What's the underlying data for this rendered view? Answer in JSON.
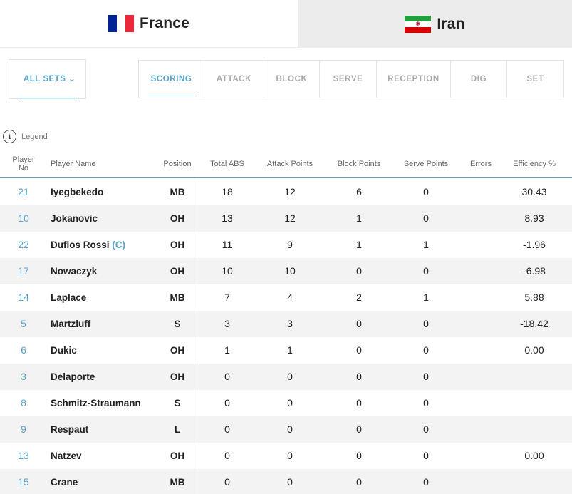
{
  "teams": [
    {
      "name": "France",
      "flag": "france-flag",
      "colors": [
        "#002395",
        "#ffffff",
        "#ed2939"
      ],
      "active": true
    },
    {
      "name": "Iran",
      "flag": "iran-flag",
      "colors": [
        "#239f40",
        "#ffffff",
        "#da0000"
      ],
      "active": false
    }
  ],
  "filters": {
    "sets_label": "ALL SETS ⌄"
  },
  "categories": [
    "SCORING",
    "ATTACK",
    "BLOCK",
    "SERVE",
    "RECEPTION",
    "DIG",
    "SET"
  ],
  "active_category": "SCORING",
  "legend": {
    "label": "Legend",
    "icon": "info-icon"
  },
  "table": {
    "headers": {
      "player_no_line1": "Player",
      "player_no_line2": "No",
      "player_name": "Player Name",
      "position": "Position",
      "total_abs": "Total ABS",
      "attack_points": "Attack Points",
      "block_points": "Block Points",
      "serve_points": "Serve Points",
      "errors": "Errors",
      "efficiency": "Efficiency %"
    },
    "rows": [
      {
        "no": "21",
        "name": "Iyegbekedo",
        "captain": "",
        "pos": "MB",
        "abs": "18",
        "att": "12",
        "blk": "6",
        "srv": "0",
        "err": "",
        "eff": "30.43"
      },
      {
        "no": "10",
        "name": "Jokanovic",
        "captain": "",
        "pos": "OH",
        "abs": "13",
        "att": "12",
        "blk": "1",
        "srv": "0",
        "err": "",
        "eff": "8.93"
      },
      {
        "no": "22",
        "name": "Duflos Rossi",
        "captain": "(C)",
        "pos": "OH",
        "abs": "11",
        "att": "9",
        "blk": "1",
        "srv": "1",
        "err": "",
        "eff": "-1.96"
      },
      {
        "no": "17",
        "name": "Nowaczyk",
        "captain": "",
        "pos": "OH",
        "abs": "10",
        "att": "10",
        "blk": "0",
        "srv": "0",
        "err": "",
        "eff": "-6.98"
      },
      {
        "no": "14",
        "name": "Laplace",
        "captain": "",
        "pos": "MB",
        "abs": "7",
        "att": "4",
        "blk": "2",
        "srv": "1",
        "err": "",
        "eff": "5.88"
      },
      {
        "no": "5",
        "name": "Martzluff",
        "captain": "",
        "pos": "S",
        "abs": "3",
        "att": "3",
        "blk": "0",
        "srv": "0",
        "err": "",
        "eff": "-18.42"
      },
      {
        "no": "6",
        "name": "Dukic",
        "captain": "",
        "pos": "OH",
        "abs": "1",
        "att": "1",
        "blk": "0",
        "srv": "0",
        "err": "",
        "eff": "0.00"
      },
      {
        "no": "3",
        "name": "Delaporte",
        "captain": "",
        "pos": "OH",
        "abs": "0",
        "att": "0",
        "blk": "0",
        "srv": "0",
        "err": "",
        "eff": ""
      },
      {
        "no": "8",
        "name": "Schmitz-Straumann",
        "captain": "",
        "pos": "S",
        "abs": "0",
        "att": "0",
        "blk": "0",
        "srv": "0",
        "err": "",
        "eff": ""
      },
      {
        "no": "9",
        "name": "Respaut",
        "captain": "",
        "pos": "L",
        "abs": "0",
        "att": "0",
        "blk": "0",
        "srv": "0",
        "err": "",
        "eff": ""
      },
      {
        "no": "13",
        "name": "Natzev",
        "captain": "",
        "pos": "OH",
        "abs": "0",
        "att": "0",
        "blk": "0",
        "srv": "0",
        "err": "",
        "eff": "0.00"
      },
      {
        "no": "15",
        "name": "Crane",
        "captain": "",
        "pos": "MB",
        "abs": "0",
        "att": "0",
        "blk": "0",
        "srv": "0",
        "err": "",
        "eff": ""
      }
    ]
  },
  "colors": {
    "accent": "#5aa3c7",
    "alt_row": "#f3f3f3",
    "inactive_tab": "#ececec"
  }
}
